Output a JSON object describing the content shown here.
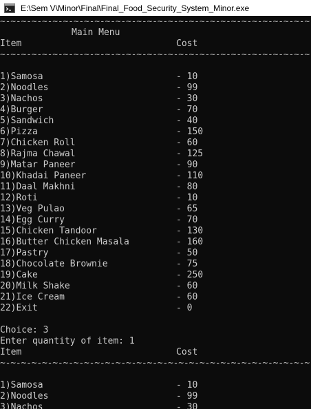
{
  "window": {
    "title": "E:\\Sem V\\Minor\\Final\\Final_Food_Security_System_Minor.exe",
    "icon": "console-app-icon"
  },
  "console": {
    "rule": "~-~-~-~-~-~-~-~-~-~-~-~-~-~-~-~-~-~-~-~-~-~-~-~-~-~-~-~-~-~-~-~-~-~-~-~",
    "menu_title": "Main Menu",
    "header_item": "Item",
    "header_cost": "Cost",
    "menu": [
      {
        "item": "1)Samosa",
        "cost": "- 10"
      },
      {
        "item": "2)Noodles",
        "cost": "- 99"
      },
      {
        "item": "3)Nachos",
        "cost": "- 30"
      },
      {
        "item": "4)Burger",
        "cost": "- 70"
      },
      {
        "item": "5)Sandwich",
        "cost": "- 40"
      },
      {
        "item": "6)Pizza",
        "cost": "- 150"
      },
      {
        "item": "7)Chicken Roll",
        "cost": "- 60"
      },
      {
        "item": "8)Rajma Chawal",
        "cost": "- 125"
      },
      {
        "item": "9)Matar Paneer",
        "cost": "- 90"
      },
      {
        "item": "10)Khadai Paneer",
        "cost": "- 110"
      },
      {
        "item": "11)Daal Makhni",
        "cost": "- 80"
      },
      {
        "item": "12)Roti",
        "cost": "- 10"
      },
      {
        "item": "13)Veg Pulao",
        "cost": "- 65"
      },
      {
        "item": "14)Egg Curry",
        "cost": "- 70"
      },
      {
        "item": "15)Chicken Tandoor",
        "cost": "- 130"
      },
      {
        "item": "16)Butter Chicken Masala",
        "cost": "- 160"
      },
      {
        "item": "17)Pastry",
        "cost": "- 50"
      },
      {
        "item": "18)Chocolate Brownie",
        "cost": "- 75"
      },
      {
        "item": "19)Cake",
        "cost": "- 250"
      },
      {
        "item": "20)Milk Shake",
        "cost": "- 60"
      },
      {
        "item": "21)Ice Cream",
        "cost": "- 60"
      },
      {
        "item": "22)Exit",
        "cost": "- 0"
      }
    ],
    "choice_line": "Choice: 3",
    "quantity_line": "Enter quantity of item: 1",
    "menu2": [
      {
        "item": "1)Samosa",
        "cost": "- 10"
      },
      {
        "item": "2)Noodles",
        "cost": "- 99"
      },
      {
        "item": "3)Nachos",
        "cost": "- 30"
      }
    ],
    "colors": {
      "background": "#0c0c0c",
      "text": "#cccccc",
      "titlebar": "#ffffff"
    }
  }
}
